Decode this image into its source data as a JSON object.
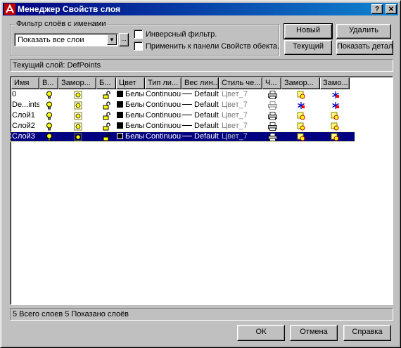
{
  "window": {
    "title": "Менеджер Свойств слоя",
    "help_label": "?",
    "close_label": "✕"
  },
  "filter": {
    "group_label": "Фильтр слоёв с именами",
    "combo_value": "Показать все слои",
    "dots_label": "...",
    "invert_label": "Инверсный фильтр.",
    "apply_label": "Применить к панели Свойств обекта."
  },
  "buttons": {
    "new": "Новый",
    "delete": "Удалить",
    "current": "Текущий",
    "details": "Показать детали",
    "ok": "ОК",
    "cancel": "Отмена",
    "help": "Справка"
  },
  "current_layer": "Текущий слой: DefPoints",
  "columns": [
    "Имя",
    "В...",
    "Замор...",
    "Б...",
    "Цвет",
    "Тип ли...",
    "Вес лин...",
    "Стиль че...",
    "Ч...",
    "Замор...",
    "Замо..."
  ],
  "layers": [
    {
      "name": "0",
      "color": "Белы",
      "linetype": "Continuous",
      "lineweight": "Default",
      "plotstyle": "Цвет_7",
      "plot": "printer",
      "selected": false
    },
    {
      "name": "De...ints",
      "color": "Белы",
      "linetype": "Continuous",
      "lineweight": "Default",
      "plotstyle": "Цвет_7",
      "plot": "printer-off",
      "selected": false
    },
    {
      "name": "Слой1",
      "color": "Белы",
      "linetype": "Continuous",
      "lineweight": "Default",
      "plotstyle": "Цвет_7",
      "plot": "printer",
      "selected": false
    },
    {
      "name": "Слой2",
      "color": "Белы",
      "linetype": "Continuous",
      "lineweight": "Default",
      "plotstyle": "Цвет_7",
      "plot": "printer",
      "selected": false
    },
    {
      "name": "Слой3",
      "color": "Белы",
      "linetype": "Continuous",
      "lineweight": "Default",
      "plotstyle": "Цвет_7",
      "plot": "printer",
      "selected": true
    }
  ],
  "status": "5 Всего слоев   5 Показано слоёв",
  "colors": {
    "title_start": "#000080",
    "title_end": "#1084d0",
    "selection": "#000080",
    "face": "#c0c0c0"
  }
}
